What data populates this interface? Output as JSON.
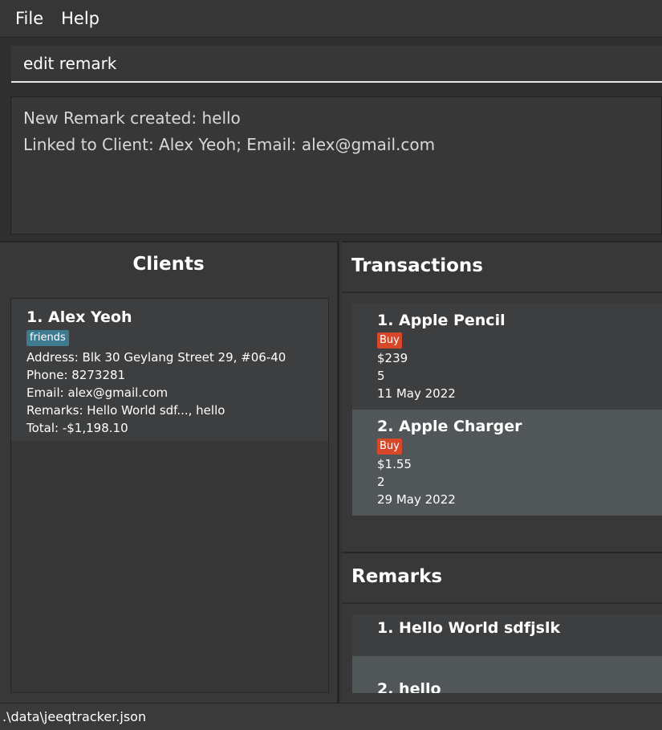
{
  "menu": {
    "file": "File",
    "help": "Help"
  },
  "command": {
    "value": "edit remark"
  },
  "result": {
    "line1": "New Remark created: hello",
    "line2": "Linked to Client: Alex Yeoh; Email: alex@gmail.com"
  },
  "clients": {
    "title": "Clients",
    "items": [
      {
        "title": "1.  Alex Yeoh",
        "tag": "friends",
        "address": "Address: Blk 30 Geylang Street 29, #06-40",
        "phone": "Phone: 8273281",
        "email": "Email: alex@gmail.com",
        "remarks": "Remarks: Hello World sdf..., hello",
        "total": "Total: -$1,198.10"
      }
    ]
  },
  "transactions": {
    "title": "Transactions",
    "items": [
      {
        "title": "1.  Apple Pencil",
        "type": "Buy",
        "price": "$239",
        "quantity": "5",
        "date": "11 May 2022"
      },
      {
        "title": "2.  Apple Charger",
        "type": "Buy",
        "price": "$1.55",
        "quantity": "2",
        "date": "29 May 2022"
      }
    ]
  },
  "remarks": {
    "title": "Remarks",
    "items": [
      {
        "title": "1.  Hello World sdfjslk"
      },
      {
        "title": "2.  hello"
      }
    ]
  },
  "status": {
    "path": ".\\data\\jeeqtracker.json"
  },
  "colors": {
    "background": "#333333",
    "tag_friends": "#3e7b91",
    "tag_buy": "#d7482b",
    "card_odd": "#3c3e3f",
    "card_even": "#515658"
  }
}
